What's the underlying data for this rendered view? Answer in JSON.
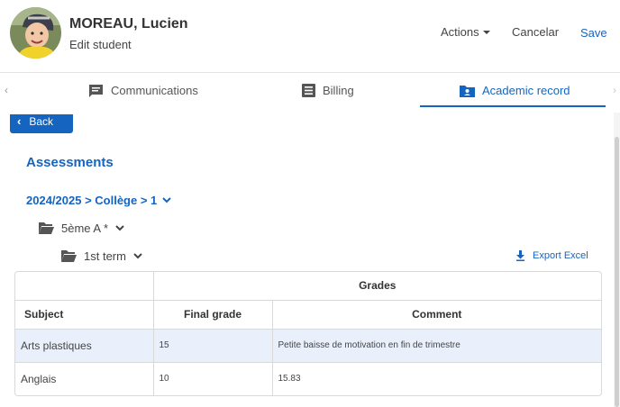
{
  "header": {
    "name": "MOREAU, Lucien",
    "subtitle": "Edit student",
    "actions_label": "Actions",
    "cancel_label": "Cancelar",
    "save_label": "Save"
  },
  "tabs": [
    {
      "label": "Communications",
      "icon": "message-icon",
      "active": false
    },
    {
      "label": "Billing",
      "icon": "list-icon",
      "active": false
    },
    {
      "label": "Academic record",
      "icon": "folder-user-icon",
      "active": true
    }
  ],
  "back_label": "Back",
  "section_title": "Assessments",
  "breadcrumb": "2024/2025 > Collège > 1",
  "class_folder": "5ème A *",
  "term_folder": "1st term",
  "export_label": "Export Excel",
  "table": {
    "group_header": "Grades",
    "columns": [
      "Subject",
      "Final grade",
      "Comment"
    ],
    "rows": [
      {
        "subject": "Arts plastiques",
        "final_grade": "15",
        "comment": "Petite baisse de motivation en fin de trimestre",
        "highlighted": true
      },
      {
        "subject": "Anglais",
        "final_grade": "10",
        "comment": "15.83",
        "highlighted": false
      }
    ]
  },
  "colors": {
    "accent": "#1565c0",
    "highlight_row": "#eaf0fb"
  }
}
